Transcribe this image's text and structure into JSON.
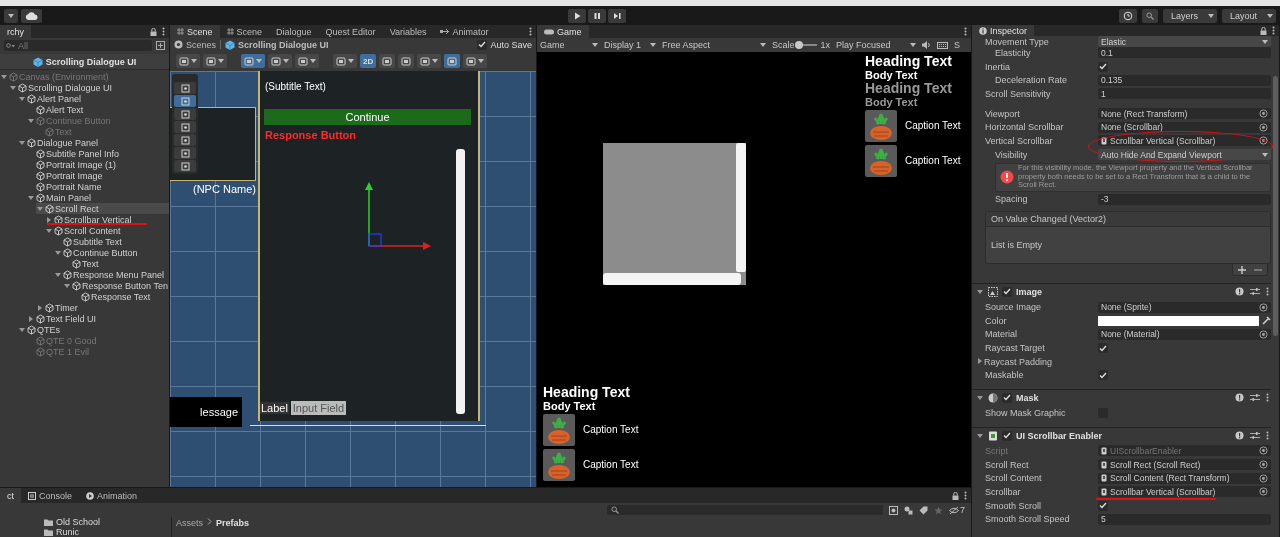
{
  "toolbar": {
    "play_controls": [
      {
        "kind": "play"
      },
      {
        "kind": "pause"
      },
      {
        "kind": "step"
      }
    ],
    "dropdowns": [
      {
        "label": "Layers"
      },
      {
        "label": "Layout"
      }
    ]
  },
  "hierarchy": {
    "tab": "rchy",
    "search": {
      "placeholder": "All"
    },
    "scene_header": "Scrolling Dialogue UI",
    "items": [
      {
        "label": "Canvas (Environment)",
        "kind": "parent",
        "expanded": true,
        "active": false,
        "selected": false,
        "children": [
          {
            "label": "Scrolling Dialogue UI",
            "kind": "parent",
            "expanded": true,
            "active": true,
            "selected": false,
            "children": [
              {
                "label": "Alert Panel",
                "kind": "parent",
                "expanded": true,
                "active": true,
                "selected": false,
                "children": [
                  {
                    "label": "Alert Text",
                    "kind": "leaf",
                    "active": true,
                    "selected": false
                  },
                  {
                    "label": "Continue Button",
                    "kind": "parent",
                    "expanded": true,
                    "active": false,
                    "selected": false,
                    "children": [
                      {
                        "label": "Text",
                        "kind": "leaf",
                        "active": false,
                        "selected": false
                      }
                    ]
                  }
                ]
              },
              {
                "label": "Dialogue Panel",
                "kind": "parent",
                "expanded": true,
                "active": true,
                "selected": false,
                "children": [
                  {
                    "label": "Subtitle Panel Info",
                    "kind": "leaf",
                    "active": true,
                    "selected": false
                  },
                  {
                    "label": "Portrait Image (1)",
                    "kind": "leaf",
                    "active": true,
                    "selected": false
                  },
                  {
                    "label": "Portrait Image",
                    "kind": "leaf",
                    "active": true,
                    "selected": false
                  },
                  {
                    "label": "Portrait Name",
                    "kind": "leaf",
                    "active": true,
                    "selected": false
                  },
                  {
                    "label": "Main Panel",
                    "kind": "parent",
                    "expanded": true,
                    "active": true,
                    "selected": false,
                    "children": [
                      {
                        "label": "Scroll Rect",
                        "kind": "parent",
                        "expanded": true,
                        "active": true,
                        "selected": true,
                        "children": [
                          {
                            "label": "Scrollbar Vertical",
                            "kind": "parent",
                            "expanded": false,
                            "active": true,
                            "selected": false,
                            "underlined": true
                          },
                          {
                            "label": "Scroll Content",
                            "kind": "parent",
                            "expanded": true,
                            "active": true,
                            "selected": false,
                            "children": [
                              {
                                "label": "Subtitle Text",
                                "kind": "leaf",
                                "active": true,
                                "selected": false
                              },
                              {
                                "label": "Continue Button",
                                "kind": "parent",
                                "expanded": true,
                                "active": true,
                                "selected": false,
                                "children": [
                                  {
                                    "label": "Text",
                                    "kind": "leaf",
                                    "active": true,
                                    "selected": false
                                  }
                                ]
                              },
                              {
                                "label": "Response Menu Panel",
                                "kind": "parent",
                                "expanded": true,
                                "active": true,
                                "selected": false,
                                "children": [
                                  {
                                    "label": "Response Button Ten",
                                    "kind": "parent",
                                    "expanded": true,
                                    "active": true,
                                    "selected": false,
                                    "children": [
                                      {
                                        "label": "Response Text",
                                        "kind": "leaf",
                                        "active": true,
                                        "selected": false
                                      }
                                    ]
                                  }
                                ]
                              }
                            ]
                          }
                        ]
                      },
                      {
                        "label": "Timer",
                        "kind": "parent",
                        "expanded": false,
                        "active": true,
                        "selected": false
                      }
                    ]
                  },
                  {
                    "label": "Text Field UI",
                    "kind": "parent",
                    "expanded": false,
                    "active": true,
                    "selected": false
                  }
                ]
              },
              {
                "label": "QTEs",
                "kind": "parent",
                "expanded": true,
                "active": true,
                "selected": false,
                "children": [
                  {
                    "label": "QTE 0 Good",
                    "kind": "leaf",
                    "active": false,
                    "selected": false
                  },
                  {
                    "label": "QTE 1 Evil",
                    "kind": "leaf",
                    "active": false,
                    "selected": false
                  }
                ]
              }
            ]
          }
        ]
      }
    ]
  },
  "scene": {
    "tabs": [
      {
        "label": "Scene",
        "kind": "scene",
        "selected": true
      },
      {
        "label": "Scene",
        "kind": "scene",
        "selected": false
      },
      {
        "label": "Dialogue",
        "kind": "plain",
        "selected": false
      },
      {
        "label": "Quest Editor",
        "kind": "plain",
        "selected": false
      },
      {
        "label": "Variables",
        "kind": "plain",
        "selected": false
      },
      {
        "label": "Animator",
        "kind": "animator",
        "selected": false
      }
    ],
    "breadcrumb": [
      "Scenes",
      "Scrolling Dialogue UI"
    ],
    "auto_save": {
      "label": "Auto Save",
      "checked": true
    },
    "toolbar": [
      {
        "kind": "icon",
        "dropdown": true,
        "on": false
      },
      {
        "kind": "icon",
        "dropdown": true,
        "on": false
      },
      {
        "kind": "gap"
      },
      {
        "kind": "icon",
        "dropdown": true,
        "on": true
      },
      {
        "kind": "icon",
        "dropdown": true,
        "on": false
      },
      {
        "kind": "icon",
        "dropdown": true,
        "on": false
      },
      {
        "kind": "gap"
      },
      {
        "kind": "icon",
        "dropdown": true,
        "on": false
      },
      {
        "kind": "label",
        "label": "2D",
        "on": true
      },
      {
        "kind": "icon",
        "dropdown": false,
        "on": false
      },
      {
        "kind": "icon",
        "dropdown": false,
        "on": false
      },
      {
        "kind": "icon",
        "dropdown": true,
        "on": false
      },
      {
        "kind": "icon",
        "dropdown": false,
        "on": true
      },
      {
        "kind": "icon",
        "dropdown": true,
        "on": false
      }
    ],
    "tools": [
      {
        "selected": false
      },
      {
        "selected": true
      },
      {
        "selected": false
      },
      {
        "selected": false
      },
      {
        "selected": false
      },
      {
        "selected": false
      },
      {
        "selected": false
      }
    ],
    "view": {
      "subtitle": "(Subtitle Text)",
      "continue": "Continue",
      "response": "Response Button",
      "npc_name": "(NPC Name)",
      "message": "lessage",
      "label": "Label",
      "input": "Input Field"
    }
  },
  "game": {
    "tab": "Game",
    "dropdowns": [
      "Game",
      "Display 1",
      "Free Aspect"
    ],
    "scale": {
      "label": "Scale",
      "level": 0,
      "reading": "1x"
    },
    "play_mode": "Play Focused",
    "cut_label": "S",
    "top_right": [
      {
        "kind": "heading",
        "text": "Heading Text",
        "dim": false
      },
      {
        "kind": "body",
        "text": "Body Text",
        "dim": false
      },
      {
        "kind": "heading",
        "text": "Heading Text",
        "dim": true
      },
      {
        "kind": "body",
        "text": "Body Text",
        "dim": true
      },
      {
        "kind": "caption",
        "text": "Caption Text",
        "dim": false
      },
      {
        "kind": "caption",
        "text": "Caption Text",
        "dim": false
      }
    ],
    "bottom_left": [
      {
        "kind": "heading",
        "text": "Heading Text",
        "dim": false
      },
      {
        "kind": "body",
        "text": "Body Text",
        "dim": false
      },
      {
        "kind": "caption",
        "text": "Caption Text",
        "dim": false
      },
      {
        "kind": "caption",
        "text": "Caption Text",
        "dim": false
      }
    ]
  },
  "inspector": {
    "tab": "Inspector",
    "components": [
      {
        "kind": "tail",
        "rows": [
          {
            "label": "Movement Type",
            "kind": "dropdown",
            "value": "Elastic",
            "children": [
              {
                "label": "Elasticity",
                "kind": "text",
                "value": "0.1"
              }
            ]
          },
          {
            "label": "Inertia",
            "kind": "checkbox",
            "checked": true,
            "children": [
              {
                "label": "Deceleration Rate",
                "kind": "text",
                "value": "0.135"
              }
            ]
          },
          {
            "label": "Scroll Sensitivity",
            "kind": "text",
            "value": "1"
          },
          {
            "kind": "spacer"
          },
          {
            "label": "Viewport",
            "kind": "object",
            "value": "None (Rect Transform)",
            "assigned": false
          },
          {
            "label": "Horizontal Scrollbar",
            "kind": "object",
            "value": "None (Scrollbar)",
            "assigned": false
          },
          {
            "label": "Vertical Scrollbar",
            "kind": "object",
            "value": "Scrollbar Vertical (Scrollbar)",
            "assigned": true,
            "circled": true,
            "children": [
              {
                "label": "Visibility",
                "kind": "dropdown",
                "value": "Auto Hide And Expand Viewport"
              },
              {
                "kind": "helpbox",
                "value": "For this visibility mode, the Viewport property and the Vertical Scrollbar property both needs to be set to a Rect Transform that is a child to the Scroll Rect."
              },
              {
                "label": "Spacing",
                "kind": "text",
                "value": "-3"
              }
            ]
          },
          {
            "kind": "event",
            "label": "On Value Changed (Vector2)",
            "value": "List is Empty"
          }
        ]
      },
      {
        "kind": "image",
        "title": "Image",
        "enabled": true,
        "expanded": true,
        "rows": [
          {
            "label": "Source Image",
            "kind": "object",
            "value": "None (Sprite)",
            "assigned": false
          },
          {
            "label": "Color",
            "kind": "color",
            "color": "#ffffff"
          },
          {
            "label": "Material",
            "kind": "object",
            "value": "None (Material)",
            "assigned": false
          },
          {
            "label": "Raycast Target",
            "kind": "checkbox",
            "checked": true
          },
          {
            "label": "Raycast Padding",
            "kind": "foldout",
            "expanded": false
          },
          {
            "label": "Maskable",
            "kind": "checkbox",
            "checked": true
          }
        ]
      },
      {
        "kind": "mask",
        "title": "Mask",
        "enabled": true,
        "expanded": true,
        "rows": [
          {
            "label": "Show Mask Graphic",
            "kind": "checkbox",
            "checked": false
          }
        ]
      },
      {
        "kind": "script",
        "title": "UI Scrollbar Enabler",
        "enabled": true,
        "expanded": true,
        "rows": [
          {
            "label": "Script",
            "kind": "object",
            "value": "UIScrollbarEnabler",
            "assigned": true,
            "disabled": true
          },
          {
            "label": "Scroll Rect",
            "kind": "object",
            "value": "Scroll Rect (Scroll Rect)",
            "assigned": true
          },
          {
            "label": "Scroll Content",
            "kind": "object",
            "value": "Scroll Content (Rect Transform)",
            "assigned": true
          },
          {
            "label": "Scrollbar",
            "kind": "object",
            "value": "Scrollbar Vertical (Scrollbar)",
            "assigned": true,
            "underlined": true
          },
          {
            "label": "Smooth Scroll",
            "kind": "checkbox",
            "checked": true
          },
          {
            "label": "Smooth Scroll Speed",
            "kind": "text",
            "value": "5"
          }
        ]
      }
    ]
  },
  "bottom": {
    "tabs": [
      {
        "label": "ct",
        "kind": "plain",
        "selected": true
      },
      {
        "label": "Console",
        "kind": "console",
        "selected": false
      },
      {
        "label": "Animation",
        "kind": "animation",
        "selected": false
      }
    ],
    "folders": [
      "Old School",
      "Runic"
    ],
    "breadcrumb": [
      "Assets",
      "Prefabs"
    ],
    "hidden_count": "7"
  }
}
